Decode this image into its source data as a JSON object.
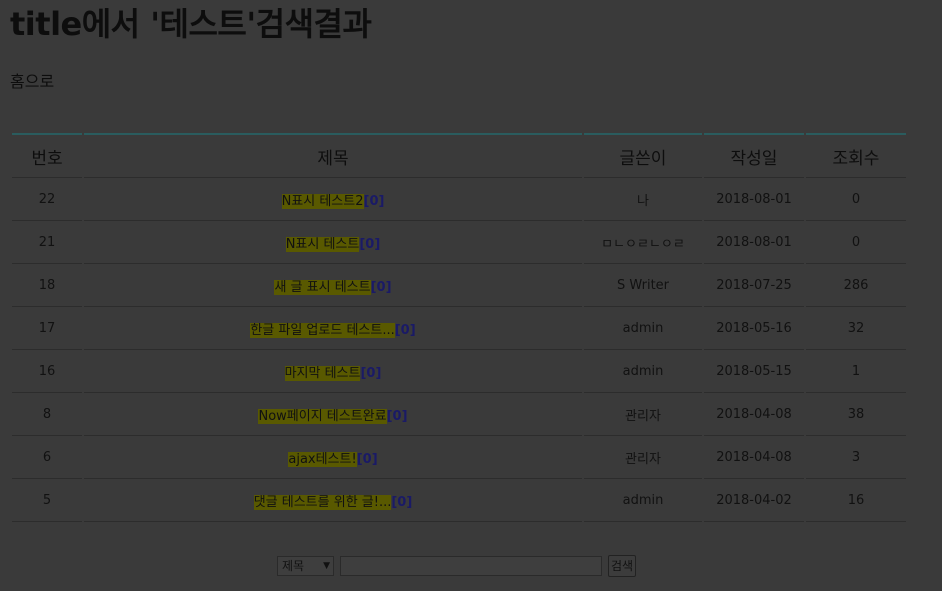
{
  "page": {
    "title": "title에서 '테스트'검색결과",
    "home_link": "홈으로"
  },
  "table": {
    "headers": [
      "번호",
      "제목",
      "글쓴이",
      "작성일",
      "조회수"
    ],
    "rows": [
      {
        "no": "22",
        "title": "N표시 테스트2",
        "comments": "[0]",
        "writer": "나",
        "date": "2018-08-01",
        "views": "0"
      },
      {
        "no": "21",
        "title": "N표시 테스트",
        "comments": "[0]",
        "writer": "ㅁㄴㅇㄹㄴㅇㄹ",
        "date": "2018-08-01",
        "views": "0"
      },
      {
        "no": "18",
        "title": "새 글 표시 테스트",
        "comments": "[0]",
        "writer": "S Writer",
        "date": "2018-07-25",
        "views": "286"
      },
      {
        "no": "17",
        "title": "한글 파일 업로드 테스트...",
        "comments": "[0]",
        "writer": "admin",
        "date": "2018-05-16",
        "views": "32"
      },
      {
        "no": "16",
        "title": "마지막 테스트",
        "comments": "[0]",
        "writer": "admin",
        "date": "2018-05-15",
        "views": "1"
      },
      {
        "no": "8",
        "title": "Now페이지 테스트완료",
        "comments": "[0]",
        "writer": "관리자",
        "date": "2018-04-08",
        "views": "38"
      },
      {
        "no": "6",
        "title": "ajax테스트!",
        "comments": "[0]",
        "writer": "관리자",
        "date": "2018-04-08",
        "views": "3"
      },
      {
        "no": "5",
        "title": "댓글 테스트를 위한 글!...",
        "comments": "[0]",
        "writer": "admin",
        "date": "2018-04-02",
        "views": "16"
      }
    ]
  },
  "search": {
    "field_selected": "제목",
    "query_value": "",
    "button_label": "검색"
  },
  "colors": {
    "highlight": "#595900",
    "header_border": "#2a5c5e",
    "background": "#3a3a3a"
  }
}
